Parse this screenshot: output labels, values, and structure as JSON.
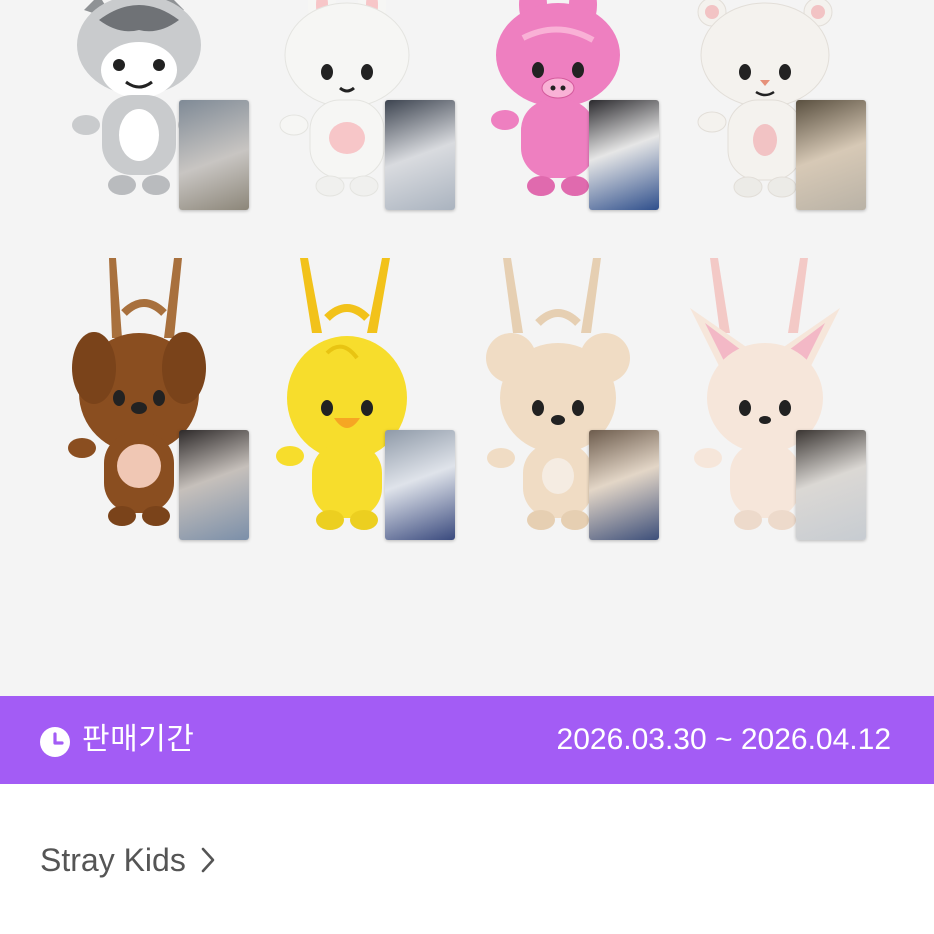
{
  "product_grid": {
    "items": [
      {
        "animal": "wolf",
        "body_color": "#c9cbcd",
        "accent": "#8f9295"
      },
      {
        "animal": "rabbit",
        "body_color": "#f6f6f4",
        "accent": "#f7c6c8"
      },
      {
        "animal": "pig-rabbit",
        "body_color": "#ee7fc0",
        "accent": "#f9b1d6"
      },
      {
        "animal": "cat",
        "body_color": "#f4f2ee",
        "accent": "#f2c3c4"
      },
      {
        "animal": "puppy",
        "body_color": "#8a4e20",
        "accent": "#f0c7b4"
      },
      {
        "animal": "chick",
        "body_color": "#f7dd2c",
        "accent": "#f6a623"
      },
      {
        "animal": "bear",
        "body_color": "#f0dcc4",
        "accent": "#f5ece2"
      },
      {
        "animal": "fox",
        "body_color": "#f6e6da",
        "accent": "#f3b8c6"
      }
    ]
  },
  "sale_period": {
    "label": "판매기간",
    "range": "2026.03.30 ~ 2026.04.12",
    "icon": "clock-icon",
    "color": "#a35cf5"
  },
  "artist": {
    "name": "Stray Kids",
    "icon": "chevron-right-icon"
  }
}
